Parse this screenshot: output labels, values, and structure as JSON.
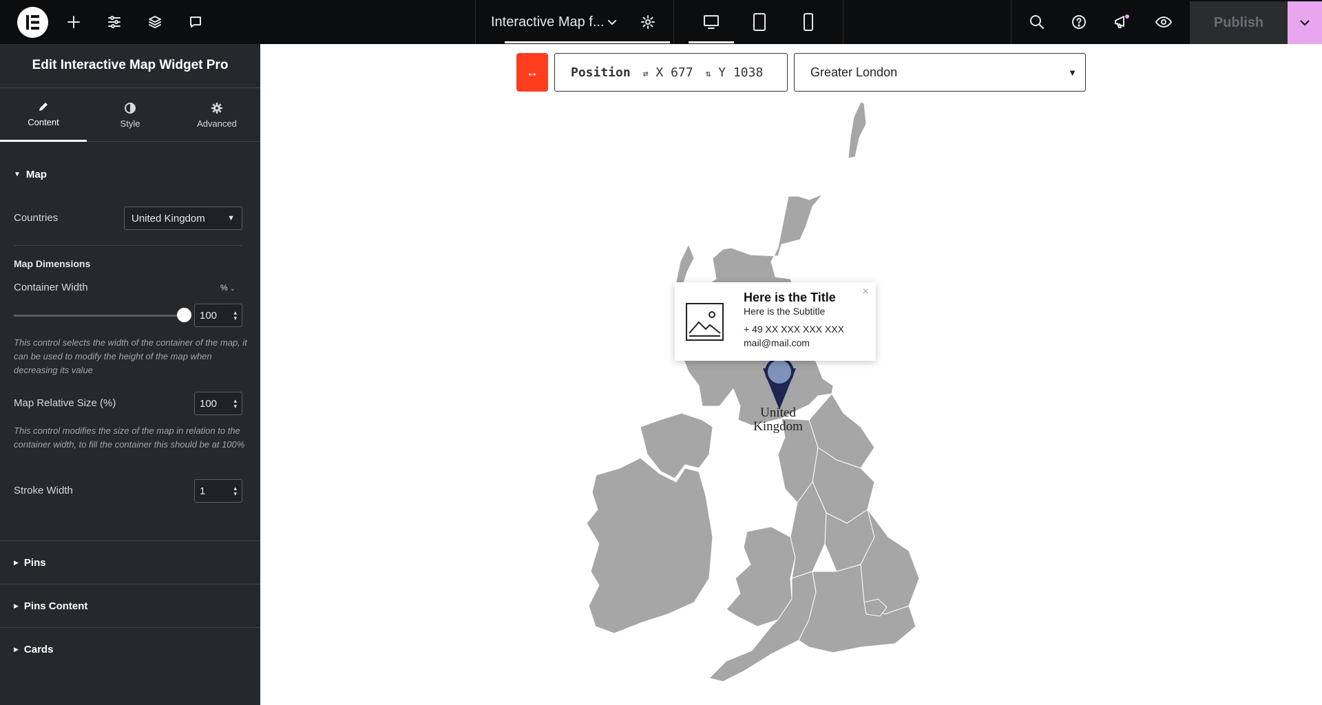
{
  "topbar": {
    "document_title": "Interactive Map f...",
    "publish_label": "Publish",
    "icons": [
      "elementor-logo-icon",
      "plus-icon",
      "sliders-icon",
      "layers-icon",
      "comment-icon",
      "chevron-down-icon",
      "gear-icon",
      "desktop-icon",
      "tablet-icon",
      "mobile-icon",
      "search-icon",
      "help-icon",
      "megaphone-icon",
      "eye-icon"
    ]
  },
  "panel": {
    "title": "Edit Interactive Map Widget Pro",
    "tabs": [
      {
        "label": "Content",
        "icon": "pencil-icon"
      },
      {
        "label": "Style",
        "icon": "half-circle-icon"
      },
      {
        "label": "Advanced",
        "icon": "gear-icon"
      }
    ],
    "map_section": {
      "heading": "Map",
      "countries_label": "Countries",
      "countries_value": "United Kingdom",
      "dimensions_heading": "Map Dimensions",
      "container_width_label": "Container Width",
      "container_width_unit": "%",
      "container_width_value": "100",
      "container_width_help": "This control selects the width of the container of the map, it can be used to modify the height of the map when decreasing its value",
      "relative_size_label": "Map Relative Size (%)",
      "relative_size_value": "100",
      "relative_size_help": "This control modifies the size of the map in relation to the container width, to fill the container this should be at 100%",
      "stroke_width_label": "Stroke Width",
      "stroke_width_value": "1"
    },
    "sections": [
      "Pins",
      "Pins Content",
      "Cards"
    ]
  },
  "canvas": {
    "position_label": "Position",
    "x_label": "X",
    "x_value": "677",
    "y_label": "Y",
    "y_value": "1038",
    "region_value": "Greater London",
    "card": {
      "title": "Here is the Title",
      "subtitle": "Here is the Subtitle",
      "phone": "+ 49 XX XXX XXX XXX",
      "email": "mail@mail.com"
    },
    "map_label_line1": "United",
    "map_label_line2": "Kingdom"
  },
  "colors": {
    "topbar_bg": "#0c0d0e",
    "panel_bg": "#26292c",
    "accent_red": "#ff3d1f",
    "accent_pink": "#e8a6f0",
    "map_fill": "#a6a6a6",
    "pin_color": "#1d2650"
  }
}
